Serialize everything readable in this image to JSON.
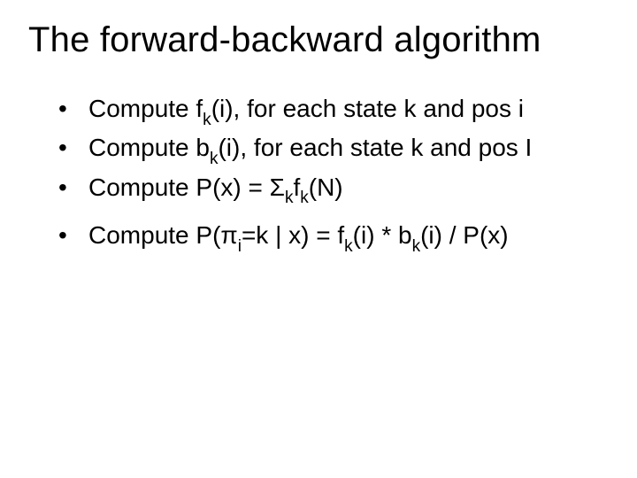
{
  "title": "The forward-backward algorithm",
  "bullets": {
    "b1": {
      "t1": "Compute f",
      "sub1": "k",
      "t2": "(i), for each state k and pos i"
    },
    "b2": {
      "t1": "Compute b",
      "sub1": "k",
      "t2": "(i), for each state k and pos I"
    },
    "b3": {
      "t1": "Compute P(x) = Σ",
      "sub1": "k",
      "t2": "f",
      "sub2": "k",
      "t3": "(N)"
    },
    "b4": {
      "t1": "Compute P(π",
      "sub1": "i",
      "t2": "=k | x) = f",
      "sub2": "k",
      "t3": "(i) * b",
      "sub3": "k",
      "t4": "(i) / P(x)"
    }
  }
}
